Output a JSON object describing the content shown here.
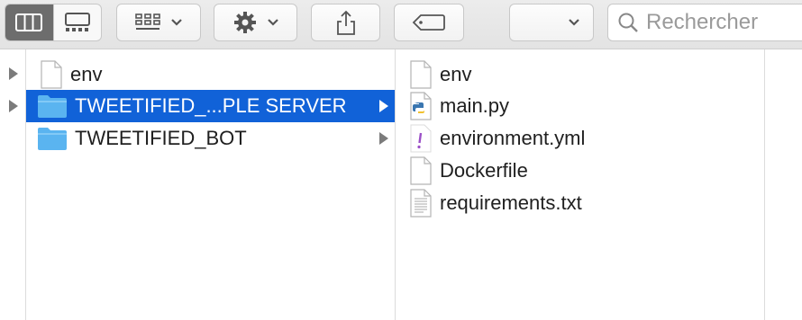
{
  "toolbar": {
    "view_buttons": [
      "column-view",
      "gallery-view"
    ],
    "group_menu": "group-by",
    "action_menu": "action",
    "share": "share",
    "tags": "tags",
    "path_menu_value": ""
  },
  "search": {
    "placeholder": "Rechercher"
  },
  "column1": {
    "items": [
      {
        "label": "env"
      }
    ]
  },
  "column2": {
    "items": [
      {
        "label": "TWEETIFIED_...PLE SERVER",
        "type": "folder",
        "selected": true
      },
      {
        "label": "TWEETIFIED_BOT",
        "type": "folder",
        "selected": false
      }
    ]
  },
  "column3": {
    "items": [
      {
        "label": "env",
        "icon": "document-icon"
      },
      {
        "label": "main.py",
        "icon": "python-file-icon"
      },
      {
        "label": "environment.yml",
        "icon": "yaml-file-icon"
      },
      {
        "label": "Dockerfile",
        "icon": "document-icon"
      },
      {
        "label": "requirements.txt",
        "icon": "text-file-icon"
      }
    ]
  },
  "colors": {
    "selection": "#1162d8",
    "folder": "#5ab4f0"
  }
}
